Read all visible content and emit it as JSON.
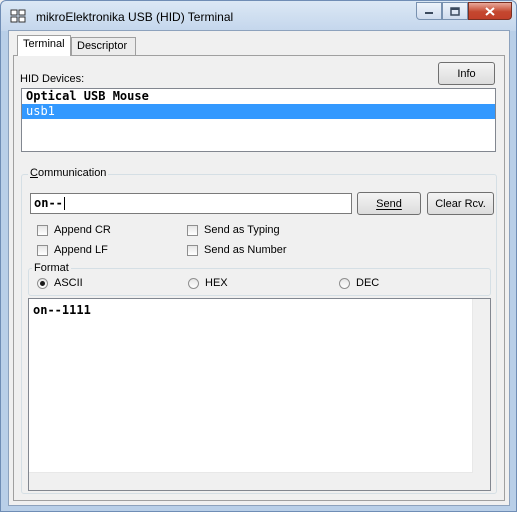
{
  "window": {
    "title": "mikroElektronika USB (HID) Terminal",
    "app_icon": "usb-terminal-icon",
    "controls": [
      "minimize-icon",
      "maximize-icon",
      "close-icon"
    ]
  },
  "tabs": [
    {
      "label": "Terminal",
      "active": true
    },
    {
      "label": "Descriptor",
      "active": false
    }
  ],
  "devices": {
    "label": "HID Devices:",
    "info_button": "Info",
    "items": [
      {
        "label": "Optical USB Mouse",
        "selected": false
      },
      {
        "label": "usb1",
        "selected": true
      }
    ]
  },
  "communication": {
    "group_title": "Communication",
    "send_value": "on--",
    "send_button": "Send",
    "clear_button": "Clear Rcv.",
    "options": [
      {
        "label": "Append CR",
        "checked": false
      },
      {
        "label": "Send as Typing",
        "checked": false
      },
      {
        "label": "Append LF",
        "checked": false
      },
      {
        "label": "Send as Number",
        "checked": false
      }
    ]
  },
  "format": {
    "group_title": "Format",
    "options": [
      {
        "label": "ASCII",
        "selected": true
      },
      {
        "label": "HEX",
        "selected": false
      },
      {
        "label": "DEC",
        "selected": false
      }
    ]
  },
  "receive": {
    "text": "on--1111"
  },
  "colors": {
    "selection": "#3399ff",
    "close_button": "#c4472f"
  }
}
